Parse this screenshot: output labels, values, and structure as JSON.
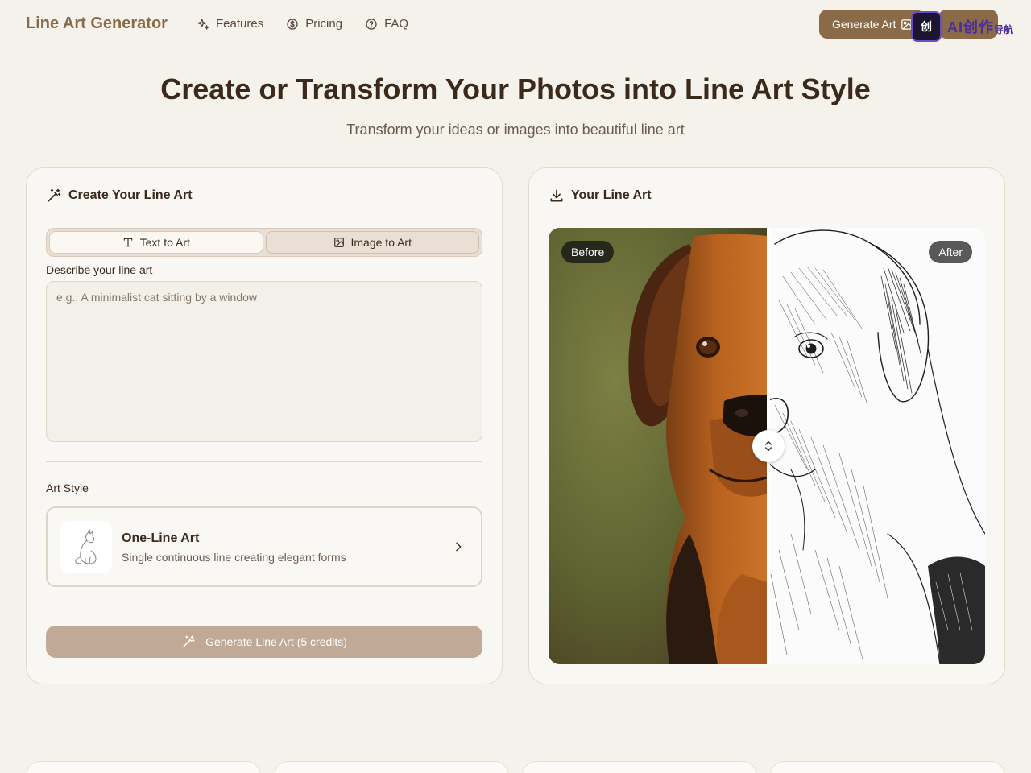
{
  "nav": {
    "logo": "Line Art Generator",
    "links": [
      {
        "label": "Features",
        "icon": "sparkles-icon"
      },
      {
        "label": "Pricing",
        "icon": "dollar-circle-icon"
      },
      {
        "label": "FAQ",
        "icon": "help-circle-icon"
      }
    ],
    "generate_label": "Generate Art",
    "watermark": {
      "logo_text": "创",
      "label": "AI创作",
      "sub": "导航"
    }
  },
  "hero": {
    "title": "Create or Transform Your Photos into Line Art Style",
    "subtitle": "Transform your ideas or images into beautiful line art"
  },
  "create_panel": {
    "title": "Create Your Line Art",
    "tabs": [
      {
        "label": "Text to Art",
        "active": true
      },
      {
        "label": "Image to Art",
        "active": false
      }
    ],
    "describe_label": "Describe your line art",
    "describe_placeholder": "e.g., A minimalist cat sitting by a window",
    "describe_value": "",
    "art_style_label": "Art Style",
    "style": {
      "name": "One-Line Art",
      "description": "Single continuous line creating elegant forms"
    },
    "submit_label": "Generate Line Art (5 credits)"
  },
  "result_panel": {
    "title": "Your Line Art",
    "before_label": "Before",
    "after_label": "After",
    "split_position": 0.5
  },
  "colors": {
    "accent": "#8b6a4a",
    "background": "#f5f2ec",
    "text": "#3b2a1c",
    "button_disabled": "#c0aa97"
  }
}
